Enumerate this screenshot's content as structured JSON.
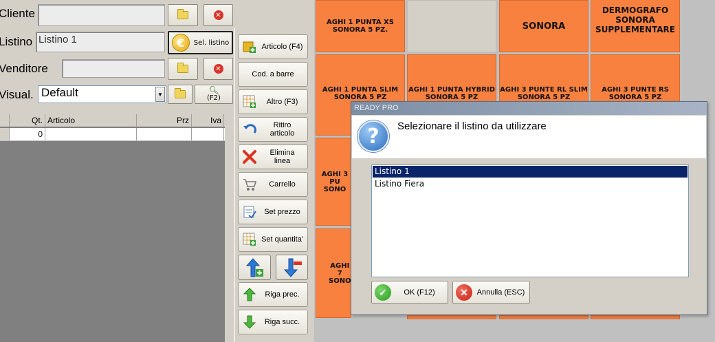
{
  "form": {
    "cliente_label": "Cliente",
    "listino_label": "Listino",
    "listino_value": "Listino 1",
    "sel_listino_label": "Sel. listino",
    "venditore_label": "Venditore",
    "visual_label": "Visual.",
    "visual_value": "Default",
    "f2_label": "(F2)"
  },
  "grid": {
    "columns": [
      "",
      "Qt.",
      "Articolo",
      "Prz",
      "Iva"
    ],
    "rows": [
      [
        "",
        "0",
        "",
        "",
        ""
      ]
    ]
  },
  "side_buttons": [
    {
      "label": "Articolo (F4)",
      "icon": "article-add-icon"
    },
    {
      "label": "Cod. a barre",
      "icon": ""
    },
    {
      "label": "Altro (F3)",
      "icon": "grid-icon"
    },
    {
      "label": "Ritiro articolo",
      "icon": "return-arrow-icon"
    },
    {
      "label": "Elimina linea",
      "icon": "delete-x-icon"
    },
    {
      "label": "Carrello",
      "icon": "cart-icon"
    },
    {
      "label": "Set prezzo",
      "icon": "price-icon"
    },
    {
      "label": "Set quantita'",
      "icon": "quantity-icon"
    },
    {
      "label": "Riga prec.",
      "icon": "arrow-up-icon"
    },
    {
      "label": "Riga succ.",
      "icon": "arrow-down-icon"
    }
  ],
  "tiles": {
    "t1": "AGHI 1 PUNTA XS SONORA 5 PZ.",
    "t2": "SONORA",
    "t3": "DERMOGRAFO SONORA SUPPLEMENTARE",
    "t4": "AGHI 1 PUNTA SLIM SONORA 5 PZ",
    "t5": "AGHI 1 PUNTA HYBRID SONORA 5 PZ",
    "t6": "AGHI 3 PUNTE RL SLIM SONORA 5 PZ",
    "t7": "AGHI 3 PUNTE RS SONORA 5 PZ",
    "t8": "AGHI 3 PU SONO",
    "t9": "AGHI 7 SONO"
  },
  "dialog": {
    "title": "READY PRO",
    "message": "Selezionare il listino da utilizzare",
    "options": [
      "Listino 1",
      "Listino Fiera"
    ],
    "ok_label": "OK (F12)",
    "cancel_label": "Annulla (ESC)"
  },
  "colors": {
    "tile": "#f8813f",
    "selection": "#0a246a"
  }
}
